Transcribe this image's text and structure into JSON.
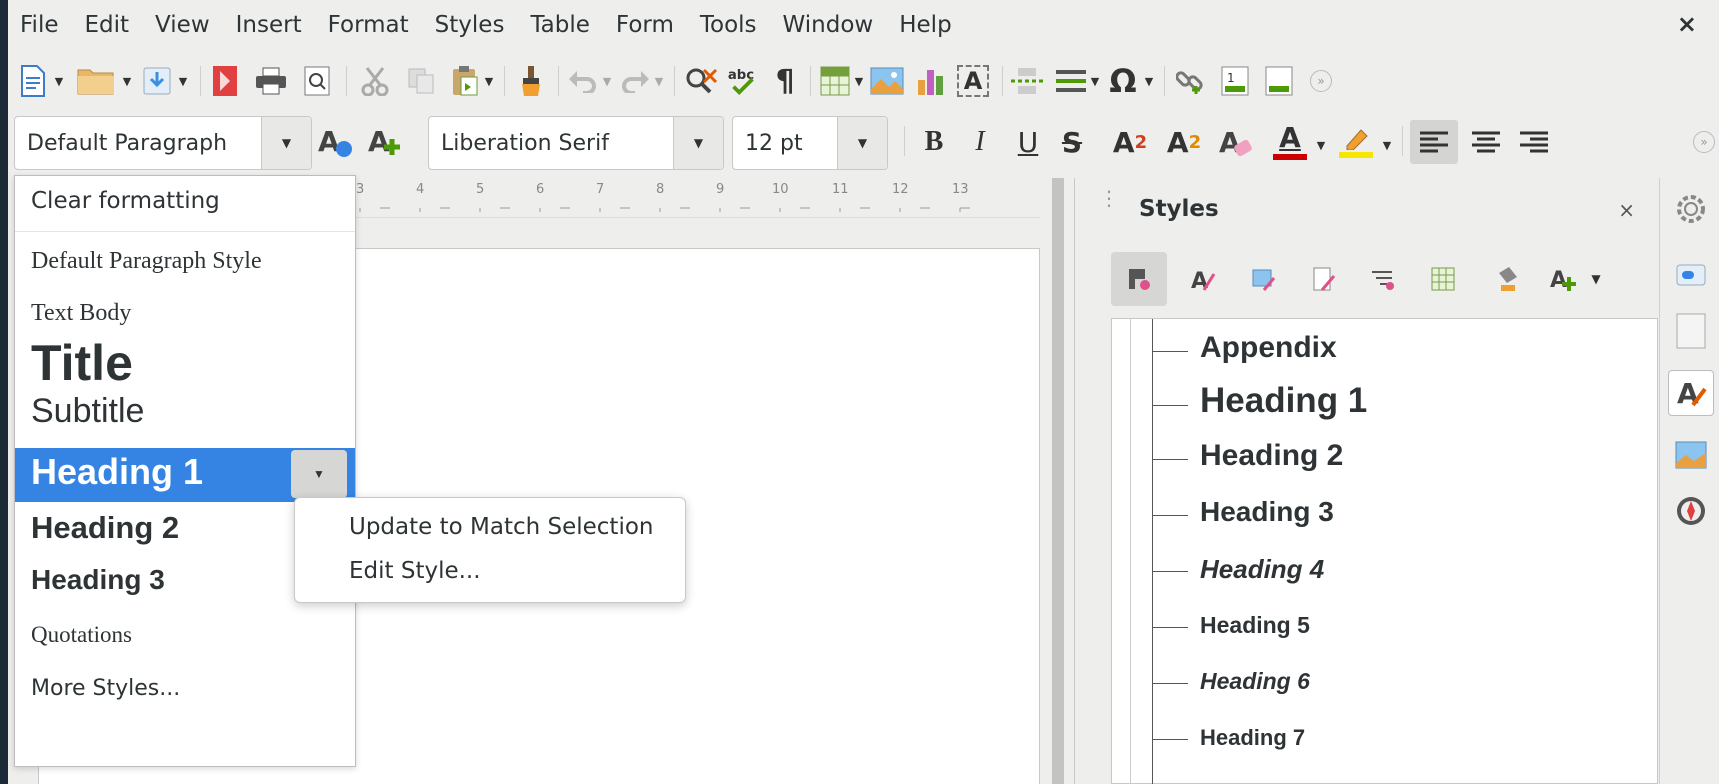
{
  "menubar": {
    "items": [
      "File",
      "Edit",
      "View",
      "Insert",
      "Format",
      "Styles",
      "Table",
      "Form",
      "Tools",
      "Window",
      "Help"
    ],
    "close": "×"
  },
  "toolbar1": {
    "icons": [
      "new-document",
      "open-folder",
      "save",
      "export-pdf",
      "print",
      "print-preview",
      "cut",
      "copy",
      "paste",
      "clone-formatting",
      "undo",
      "redo",
      "find-replace",
      "spelling",
      "formatting-marks",
      "insert-table",
      "insert-image",
      "insert-chart",
      "insert-text-box",
      "insert-page-break",
      "insert-field",
      "insert-special-character",
      "insert-hyperlink",
      "insert-footnote",
      "insert-endnote",
      "more"
    ],
    "special_char_glyph": "Ω",
    "pilcrow_glyph": "¶",
    "abc_glyph": "abc",
    "textbox_glyph": "A"
  },
  "toolbar2": {
    "paragraph_style": "Default Paragraph",
    "font_name": "Liberation Serif",
    "font_size": "12 pt",
    "bold": "B",
    "italic": "I",
    "underline": "U",
    "strikethrough": "S",
    "superscript_base": "A",
    "superscript_exp": "2",
    "subscript_base": "A",
    "subscript_idx": "2",
    "font_color_glyph": "A",
    "font_color": "#cc0000",
    "highlight_color": "#f5e700"
  },
  "ruler": {
    "numbers": [
      "3",
      "4",
      "5",
      "6",
      "7",
      "8",
      "9",
      "10",
      "11",
      "12",
      "13"
    ]
  },
  "style_list": {
    "clear": "Clear formatting",
    "items": [
      {
        "label": "Default Paragraph Style"
      },
      {
        "label": "Text Body"
      },
      {
        "label": "Title"
      },
      {
        "label": "Subtitle"
      },
      {
        "label": "Heading 1"
      },
      {
        "label": "Heading 2"
      },
      {
        "label": "Heading 3"
      },
      {
        "label": "Quotations"
      },
      {
        "label": "More Styles..."
      }
    ],
    "selected": "Heading 1"
  },
  "context_menu": {
    "update": "Update to Match Selection",
    "edit": "Edit Style..."
  },
  "sidebar": {
    "title": "Styles",
    "close": "×",
    "tree": [
      "Appendix",
      "Heading 1",
      "Heading 2",
      "Heading 3",
      "Heading 4",
      "Heading 5",
      "Heading 6",
      "Heading 7"
    ]
  },
  "colors": {
    "accent": "#3584e4",
    "window_bg": "#eeeeec"
  }
}
